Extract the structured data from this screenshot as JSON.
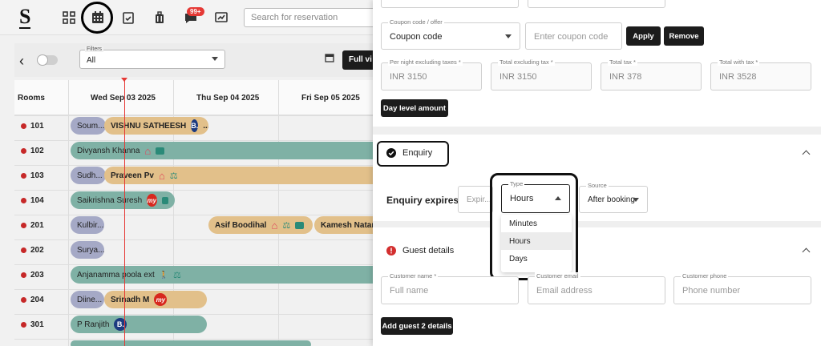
{
  "app": {
    "logo": "S",
    "notification_count": "99+",
    "search_placeholder": "Search for reservation"
  },
  "toolbar": {
    "filters_label": "Filters",
    "filters_value": "All",
    "full_view_label": "Full vi"
  },
  "calendar": {
    "rooms_header": "Rooms",
    "days": [
      "Wed Sep 03 2025",
      "Thu Sep 04 2025",
      "Fri Sep 05 2025"
    ],
    "rooms": [
      "101",
      "102",
      "103",
      "104",
      "201",
      "202",
      "203",
      "204",
      "301"
    ],
    "bookings": [
      {
        "room": "101",
        "guest": "Soum...",
        "style": "gray"
      },
      {
        "room": "101",
        "guest": "VISHNU SATHEESH",
        "style": "tan",
        "extra": "..."
      },
      {
        "room": "102",
        "guest": "Divyansh Khanna",
        "style": "teal"
      },
      {
        "room": "103",
        "guest": "Sudh...",
        "style": "gray"
      },
      {
        "room": "103",
        "guest": "Praveen Pv",
        "style": "tan"
      },
      {
        "room": "104",
        "guest": "Saikrishna Suresh",
        "style": "teal"
      },
      {
        "room": "201",
        "guest": "Kulbir...",
        "style": "gray"
      },
      {
        "room": "201",
        "guest": "Asif Boodihal",
        "style": "tan"
      },
      {
        "room": "201",
        "guest": "Kamesh Nataraj",
        "style": "tan"
      },
      {
        "room": "202",
        "guest": "Surya...",
        "style": "gray"
      },
      {
        "room": "203",
        "guest": "Anjanamma poola ext",
        "style": "teal"
      },
      {
        "room": "204",
        "guest": "Diine...",
        "style": "gray"
      },
      {
        "room": "204",
        "guest": "Srinadh M",
        "style": "tan"
      },
      {
        "room": "301",
        "guest": "P Ranjith",
        "style": "teal"
      }
    ]
  },
  "form": {
    "coupon_label": "Coupon code / offer",
    "coupon_value": "Coupon code",
    "coupon_input_placeholder": "Enter coupon code",
    "apply_label": "Apply",
    "remove_label": "Remove",
    "per_night_label": "Per night excluding taxes *",
    "per_night_value": "INR  3150",
    "total_excl_label": "Total excluding tax *",
    "total_excl_value": "INR  3150",
    "total_tax_label": "Total tax *",
    "total_tax_value": "INR  378",
    "total_with_tax_label": "Total with tax *",
    "total_with_tax_value": "INR  3528",
    "day_level_label": "Day level amount",
    "enquiry_title": "Enquiry",
    "enquiry_expires_label": "Enquiry expires in",
    "expiry_placeholder": "Expir...",
    "type_label": "Type",
    "type_value": "Hours",
    "type_options": [
      "Minutes",
      "Hours",
      "Days"
    ],
    "source_label": "Source",
    "source_value": "After booking",
    "guest_details_title": "Guest details",
    "customer_name_label": "Customer name *",
    "customer_name_placeholder": "Full name",
    "customer_email_label": "Customer email",
    "customer_email_placeholder": "Email address",
    "customer_phone_label": "Customer phone",
    "customer_phone_placeholder": "Phone number",
    "add_guest_label": "Add guest 2 details"
  },
  "colors": {
    "accent_dark": "#1c1c1c",
    "booking_gray": "#a5a9c6",
    "booking_tan": "#e2c08a",
    "booking_teal": "#7fb1a5",
    "error_red": "#d32f2f",
    "today_line": "#e53935"
  }
}
